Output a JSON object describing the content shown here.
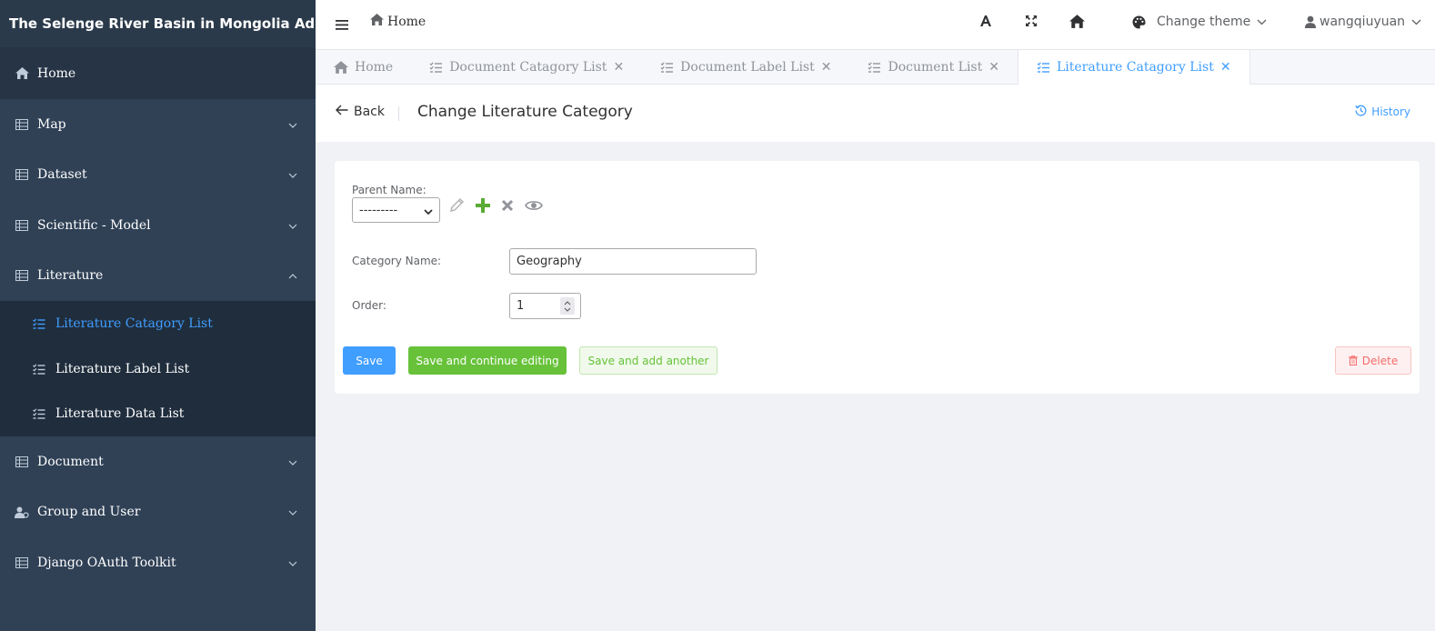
{
  "app": {
    "title": "The Selenge River Basin in Mongolia Admin"
  },
  "sidebar": {
    "items": [
      {
        "label": "Home",
        "icon": "home-icon"
      },
      {
        "label": "Map",
        "icon": "table-icon"
      },
      {
        "label": "Dataset",
        "icon": "table-icon"
      },
      {
        "label": "Scientific - Model",
        "icon": "table-icon"
      },
      {
        "label": "Literature",
        "icon": "table-icon",
        "expanded": true
      },
      {
        "label": "Document",
        "icon": "table-icon"
      },
      {
        "label": "Group and User",
        "icon": "user-group-icon"
      },
      {
        "label": "Django OAuth Toolkit",
        "icon": "table-icon"
      }
    ],
    "literature_sub": [
      {
        "label": "Literature Catagory List",
        "active": true
      },
      {
        "label": "Literature Label List"
      },
      {
        "label": "Literature Data List"
      }
    ]
  },
  "header": {
    "breadcrumb": "Home",
    "theme_label": "Change theme",
    "username": "wangqiuyuan"
  },
  "tabs": [
    {
      "label": "Home",
      "closable": false
    },
    {
      "label": "Document Catagory List",
      "closable": true
    },
    {
      "label": "Document Label List",
      "closable": true
    },
    {
      "label": "Document List",
      "closable": true
    },
    {
      "label": "Literature Catagory List",
      "closable": true,
      "active": true
    }
  ],
  "page": {
    "back_label": "Back",
    "title": "Change Literature Category",
    "history_label": "History"
  },
  "form": {
    "parent_label": "Parent Name:",
    "parent_value": "---------",
    "category_label": "Category Name:",
    "category_value": "Geography",
    "order_label": "Order:",
    "order_value": "1"
  },
  "buttons": {
    "save": "Save",
    "save_continue": "Save and continue editing",
    "save_add": "Save and add another",
    "delete": "Delete"
  },
  "colors": {
    "sidebar_bg": "#304156",
    "submenu_bg": "#1f2d3d",
    "accent": "#409eff",
    "success": "#67c23a",
    "danger": "#f56c6c"
  }
}
